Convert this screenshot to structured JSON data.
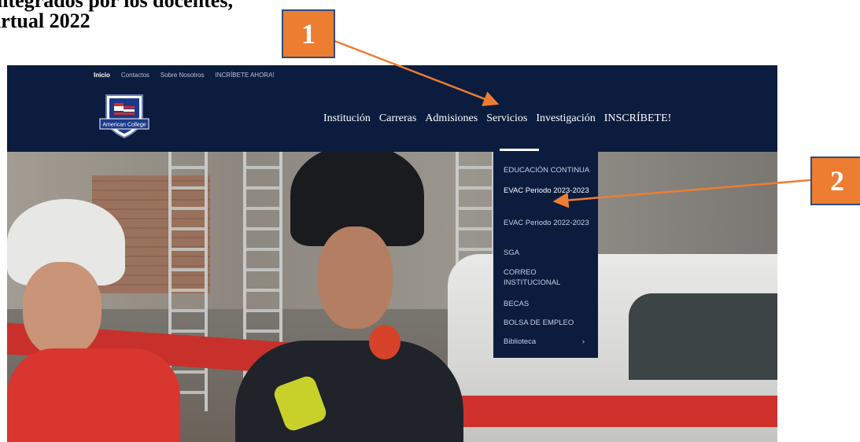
{
  "document": {
    "title_line1": "ntegrados por los docentes, ",
    "title_line2": "irtual 2022"
  },
  "site": {
    "top_links": [
      {
        "label": "Inicio",
        "active": true
      },
      {
        "label": "Contactos",
        "active": false
      },
      {
        "label": "Sobre Nosotros",
        "active": false
      },
      {
        "label": "INCRÍBETE AHORA!",
        "active": false
      }
    ],
    "logo_text": "American College",
    "main_nav": [
      "Institución",
      "Carreras",
      "Admisiones",
      "Servicios",
      "Investigación",
      "INSCRÍBETE!"
    ],
    "active_nav": "Servicios",
    "dropdown": [
      {
        "label": "EDUCACIÓN CONTINUA"
      },
      {
        "label": "EVAC Periodo 2023-2023"
      },
      {
        "label": "EVAC Periodo 2022-2023"
      },
      {
        "label": "SGA"
      },
      {
        "label": "CORREO INSTITUCIONAL"
      },
      {
        "label": "BECAS"
      },
      {
        "label": "BOLSA DE EMPLEO"
      },
      {
        "label": "Biblioteca",
        "chevron": "›"
      }
    ]
  },
  "callouts": [
    {
      "number": "1"
    },
    {
      "number": "2"
    }
  ],
  "colors": {
    "navy": "#0b1c3f",
    "callout_orange": "#ed7d31",
    "callout_border": "#2e4d7a"
  }
}
